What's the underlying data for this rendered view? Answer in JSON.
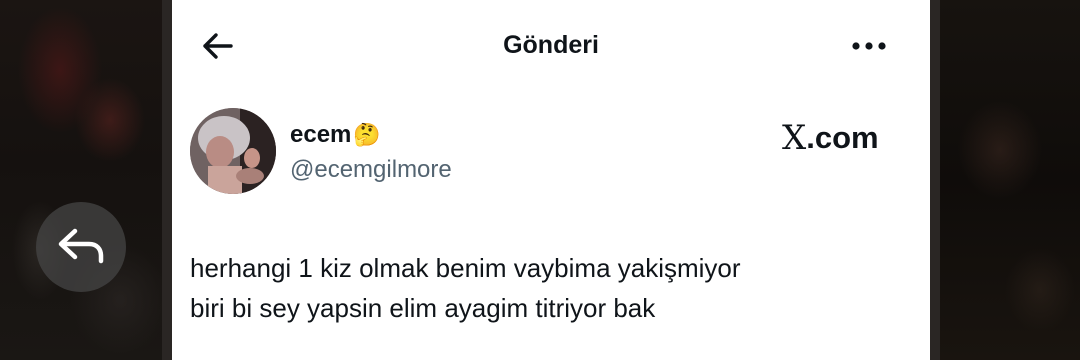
{
  "header": {
    "title": "Gönderi",
    "back_icon": "arrow-left-icon",
    "more_icon": "more-horizontal-icon"
  },
  "overlay": {
    "reply_icon": "reply-arrow-icon"
  },
  "post": {
    "author": {
      "display_name": "ecem",
      "emoji": "🤔",
      "handle": "@ecemgilmore"
    },
    "brand": {
      "logo": "X",
      "suffix": ".com"
    },
    "text_lines": [
      "herhangi 1 kiz olmak benim vaybima yakişmiyor",
      "biri bi sey yapsin elim ayagim titriyor bak"
    ]
  },
  "colors": {
    "text_primary": "#0f1419",
    "text_secondary": "#536471",
    "background": "#ffffff"
  }
}
